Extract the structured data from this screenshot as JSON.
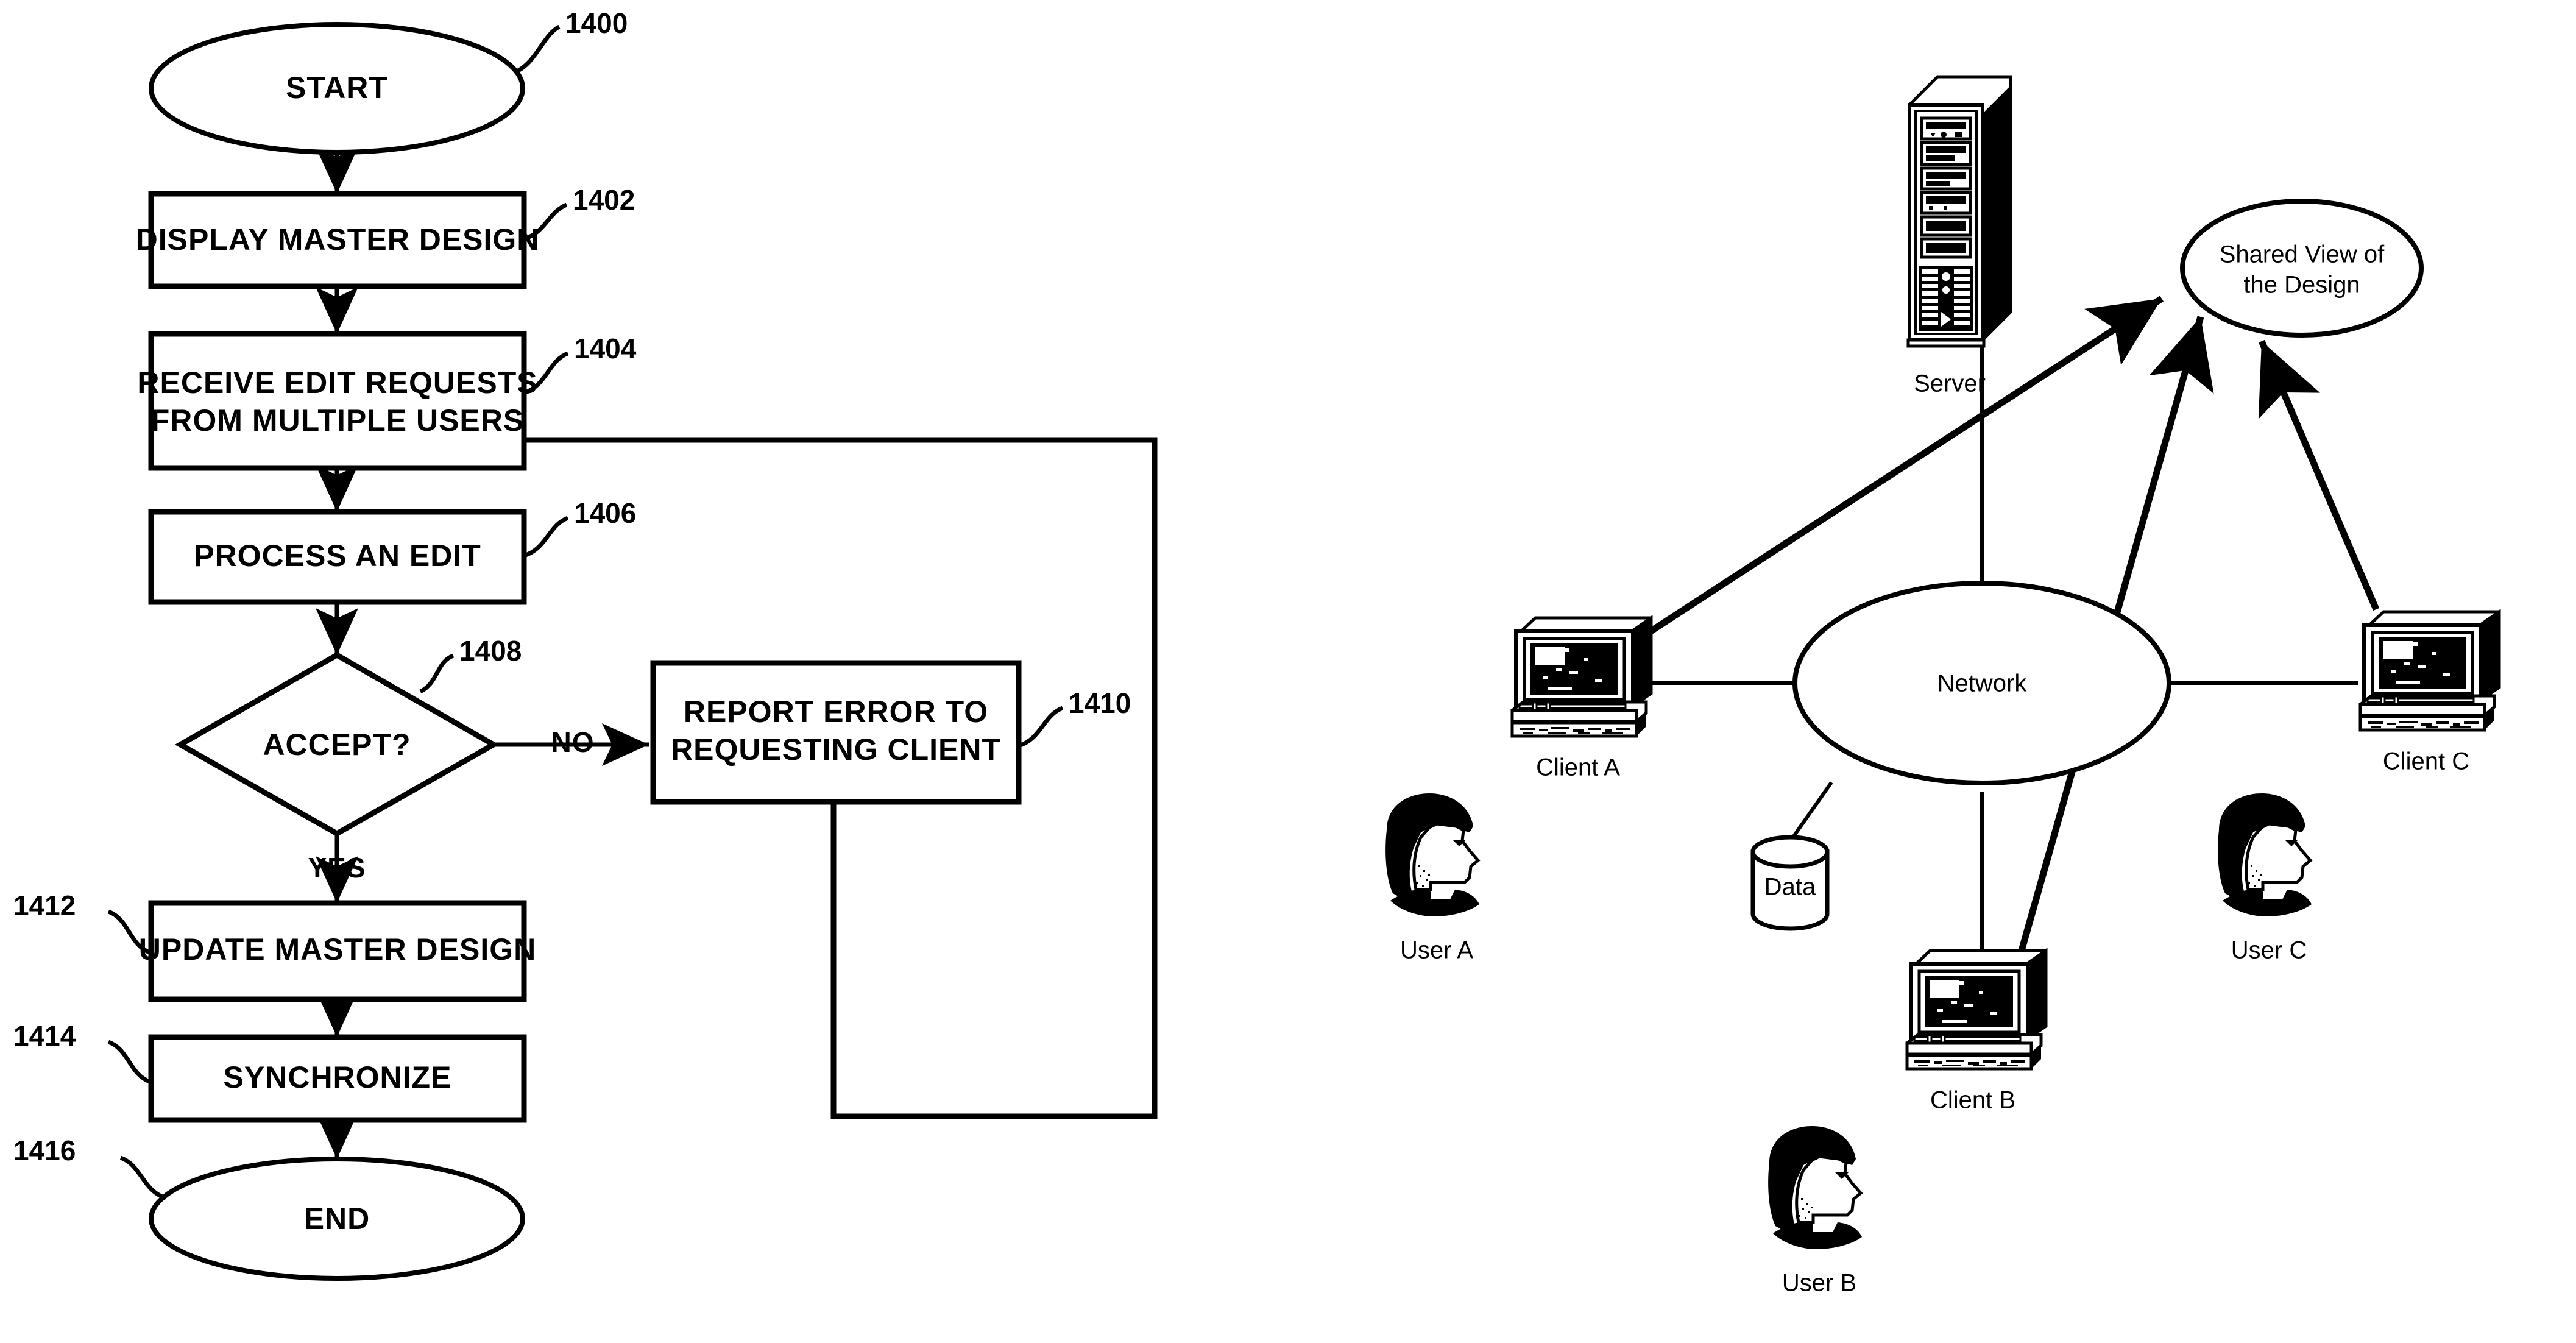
{
  "figure": {
    "flowchart": {
      "nodes": [
        {
          "id": "start",
          "ref": "1400",
          "label": "START",
          "shape": "terminator",
          "label2": ""
        },
        {
          "id": "display",
          "ref": "1402",
          "label": "DISPLAY MASTER DESIGN",
          "shape": "process",
          "label2": ""
        },
        {
          "id": "receive",
          "ref": "1404",
          "label": "RECEIVE EDIT REQUESTS",
          "shape": "process",
          "label2": "FROM MULTIPLE USERS"
        },
        {
          "id": "process",
          "ref": "1406",
          "label": "PROCESS AN EDIT",
          "shape": "process",
          "label2": ""
        },
        {
          "id": "accept",
          "ref": "1408",
          "label": "ACCEPT?",
          "shape": "decision",
          "label2": ""
        },
        {
          "id": "report",
          "ref": "1410",
          "label": "REPORT ERROR TO",
          "shape": "process",
          "label2": "REQUESTING CLIENT"
        },
        {
          "id": "update",
          "ref": "1412",
          "label": "UPDATE MASTER DESIGN",
          "shape": "process",
          "label2": ""
        },
        {
          "id": "sync",
          "ref": "1414",
          "label": "SYNCHRONIZE",
          "shape": "process",
          "label2": ""
        },
        {
          "id": "end",
          "ref": "1416",
          "label": "END",
          "shape": "terminator",
          "label2": ""
        }
      ],
      "branch_labels": {
        "no": "NO",
        "yes": "YES"
      }
    },
    "network": {
      "server_label": "Server",
      "shared_view_line1": "Shared View of",
      "shared_view_line2": "the Design",
      "network_label": "Network",
      "data_label": "Data",
      "clients": [
        {
          "id": "a",
          "label": "Client A"
        },
        {
          "id": "b",
          "label": "Client B"
        },
        {
          "id": "c",
          "label": "Client C"
        }
      ],
      "users": [
        {
          "id": "a",
          "label": "User A"
        },
        {
          "id": "b",
          "label": "User B"
        },
        {
          "id": "c",
          "label": "User C"
        }
      ]
    },
    "colors": {
      "ink": "#000000",
      "paper": "#ffffff"
    }
  }
}
